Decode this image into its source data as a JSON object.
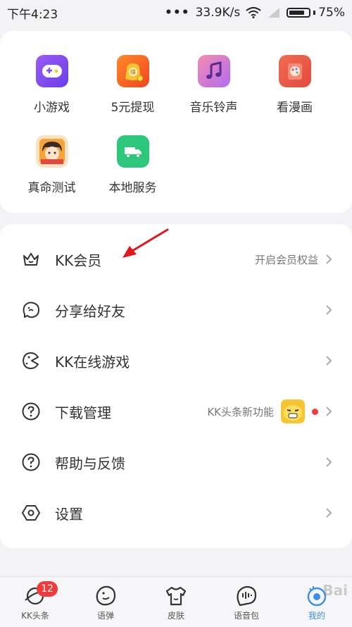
{
  "status_bar": {
    "time": "下午4:23",
    "network_speed": "33.9K/s",
    "battery_percent": "75%"
  },
  "grid": {
    "items": [
      {
        "label": "小游戏",
        "icon": "gamepad-icon",
        "color": "#7a4cf0"
      },
      {
        "label": "5元提现",
        "icon": "money-bag-icon",
        "color": "#f7b521"
      },
      {
        "label": "音乐铃声",
        "icon": "music-note-icon",
        "color": "#e96cb4"
      },
      {
        "label": "看漫画",
        "icon": "palette-book-icon",
        "color": "#ef5a45"
      },
      {
        "label": "真命测试",
        "icon": "character-gift-icon",
        "color": "#f29a32"
      },
      {
        "label": "本地服务",
        "icon": "truck-icon",
        "color": "#2cc77a"
      }
    ]
  },
  "menu": {
    "items": [
      {
        "label": "KK会员",
        "hint": "开启会员权益",
        "icon": "crown-icon"
      },
      {
        "label": "分享给好友",
        "hint": "",
        "icon": "share-face-icon"
      },
      {
        "label": "KK在线游戏",
        "hint": "",
        "icon": "game-face-icon"
      },
      {
        "label": "下载管理",
        "hint": "KK头条新功能",
        "icon": "question-icon"
      },
      {
        "label": "帮助与反馈",
        "hint": "",
        "icon": "help-icon"
      },
      {
        "label": "设置",
        "hint": "",
        "icon": "settings-hexagon-icon"
      }
    ]
  },
  "bottom_nav": {
    "items": [
      {
        "label": "KK头条",
        "badge": "12",
        "icon": "planet-icon"
      },
      {
        "label": "语弹",
        "icon": "face-icon"
      },
      {
        "label": "皮肤",
        "icon": "shirt-icon"
      },
      {
        "label": "语音包",
        "icon": "voice-icon"
      },
      {
        "label": "我的",
        "icon": "profile-icon",
        "active": true
      }
    ]
  },
  "colors": {
    "accent_blue": "#3a8ee6",
    "badge_red": "#ef3b3b",
    "arrow_red": "#e0161c"
  },
  "watermark": "Bai"
}
